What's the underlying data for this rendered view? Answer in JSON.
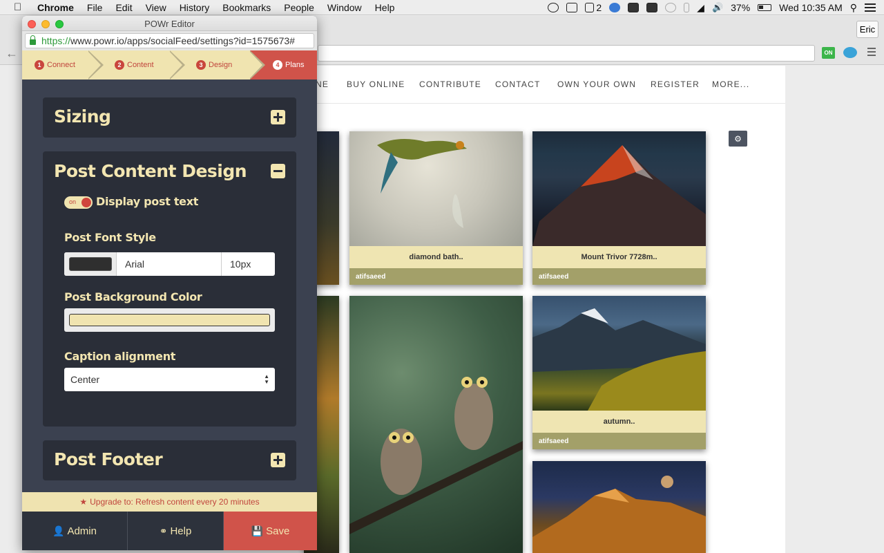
{
  "menubar": {
    "app_name": "Chrome",
    "items": [
      "File",
      "Edit",
      "View",
      "History",
      "Bookmarks",
      "People",
      "Window",
      "Help"
    ],
    "adobe_count": "2",
    "battery": "37%",
    "clock": "Wed 10:35 AM"
  },
  "browser": {
    "profile": "Eric",
    "ext_on_label": "ON"
  },
  "site": {
    "nav": [
      "NE",
      "BUY ONLINE",
      "CONTRIBUTE",
      "CONTACT",
      "OWN YOUR OWN",
      "REGISTER",
      "MORE..."
    ],
    "cards": [
      {
        "caption": "diamond bath..",
        "author": "atifsaeed"
      },
      {
        "caption": "Mount Trivor 7728m..",
        "author": "atifsaeed"
      },
      {
        "caption": "autumn..",
        "author": "atifsaeed"
      }
    ]
  },
  "editor": {
    "window_title": "POWr Editor",
    "url_scheme": "https://",
    "url_rest": "www.powr.io/apps/socialFeed/settings?id=1575673#",
    "steps": [
      {
        "num": "1",
        "label": "Connect"
      },
      {
        "num": "2",
        "label": "Content"
      },
      {
        "num": "3",
        "label": "Design"
      },
      {
        "num": "4",
        "label": "Plans"
      }
    ],
    "sections": {
      "sizing": "Sizing",
      "post_content_design": "Post Content Design",
      "post_footer": "Post Footer"
    },
    "toggle_on": "on",
    "display_post_text": "Display post text",
    "post_font_style_label": "Post Font Style",
    "font_name": "Arial",
    "font_size": "10px",
    "post_bg_label": "Post Background Color",
    "caption_alignment_label": "Caption alignment",
    "caption_alignment_value": "Center",
    "upgrade_text": "Upgrade to: Refresh content every 20 minutes",
    "buttons": {
      "admin": "Admin",
      "help": "Help",
      "save": "Save"
    },
    "colors": {
      "accent": "#d0534a",
      "cream": "#f0e4b0",
      "panel": "#2a2e38"
    }
  }
}
